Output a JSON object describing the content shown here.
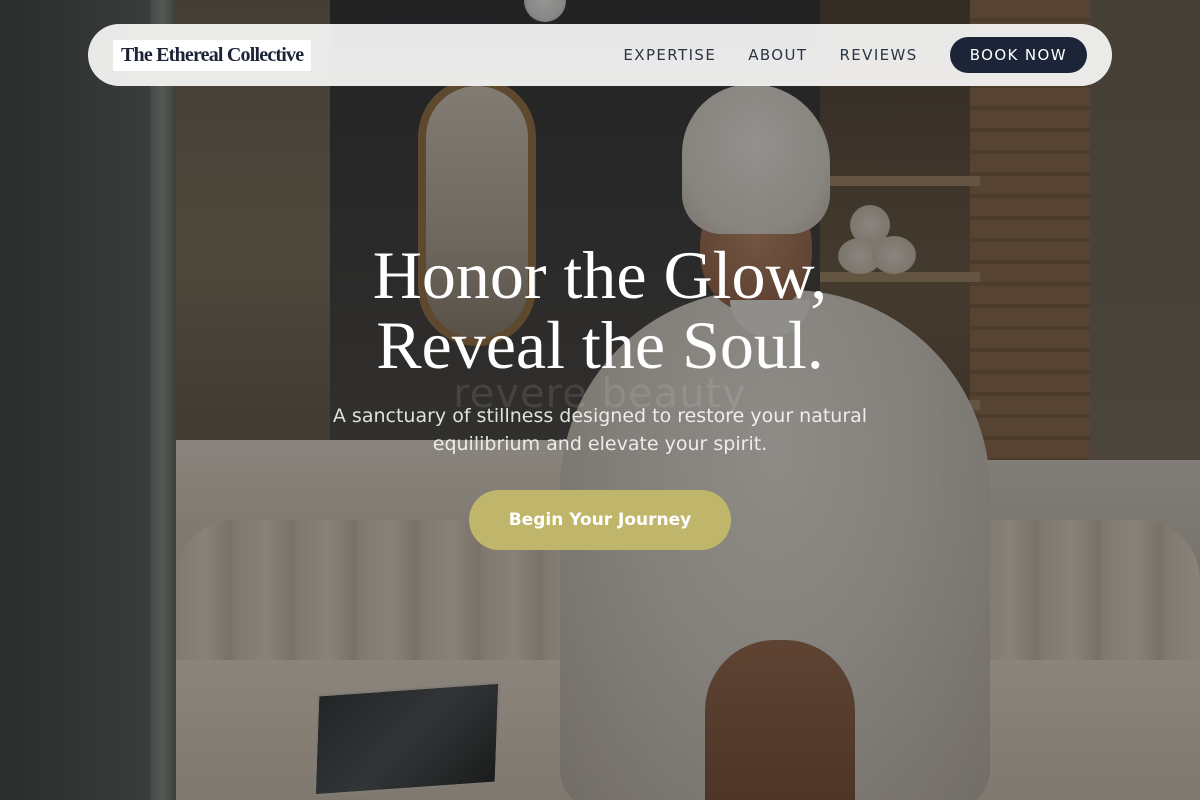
{
  "header": {
    "brand": "The Ethereal Collective",
    "nav": [
      {
        "label": "EXPERTISE"
      },
      {
        "label": "ABOUT"
      },
      {
        "label": "REVIEWS"
      }
    ],
    "cta_label": "BOOK NOW"
  },
  "hero": {
    "title_line1": "Honor the Glow,",
    "title_line2": "Reveal the Soul.",
    "watermark": "revere beauty",
    "subtitle": "A sanctuary of stillness designed to restore your natural equilibrium and elevate your spirit.",
    "button_label": "Begin Your Journey"
  },
  "colors": {
    "nav_background": "#f3f3f2",
    "brand_text": "#1c2336",
    "book_button": "#1c2438",
    "cta_button": "#bfb66c"
  }
}
